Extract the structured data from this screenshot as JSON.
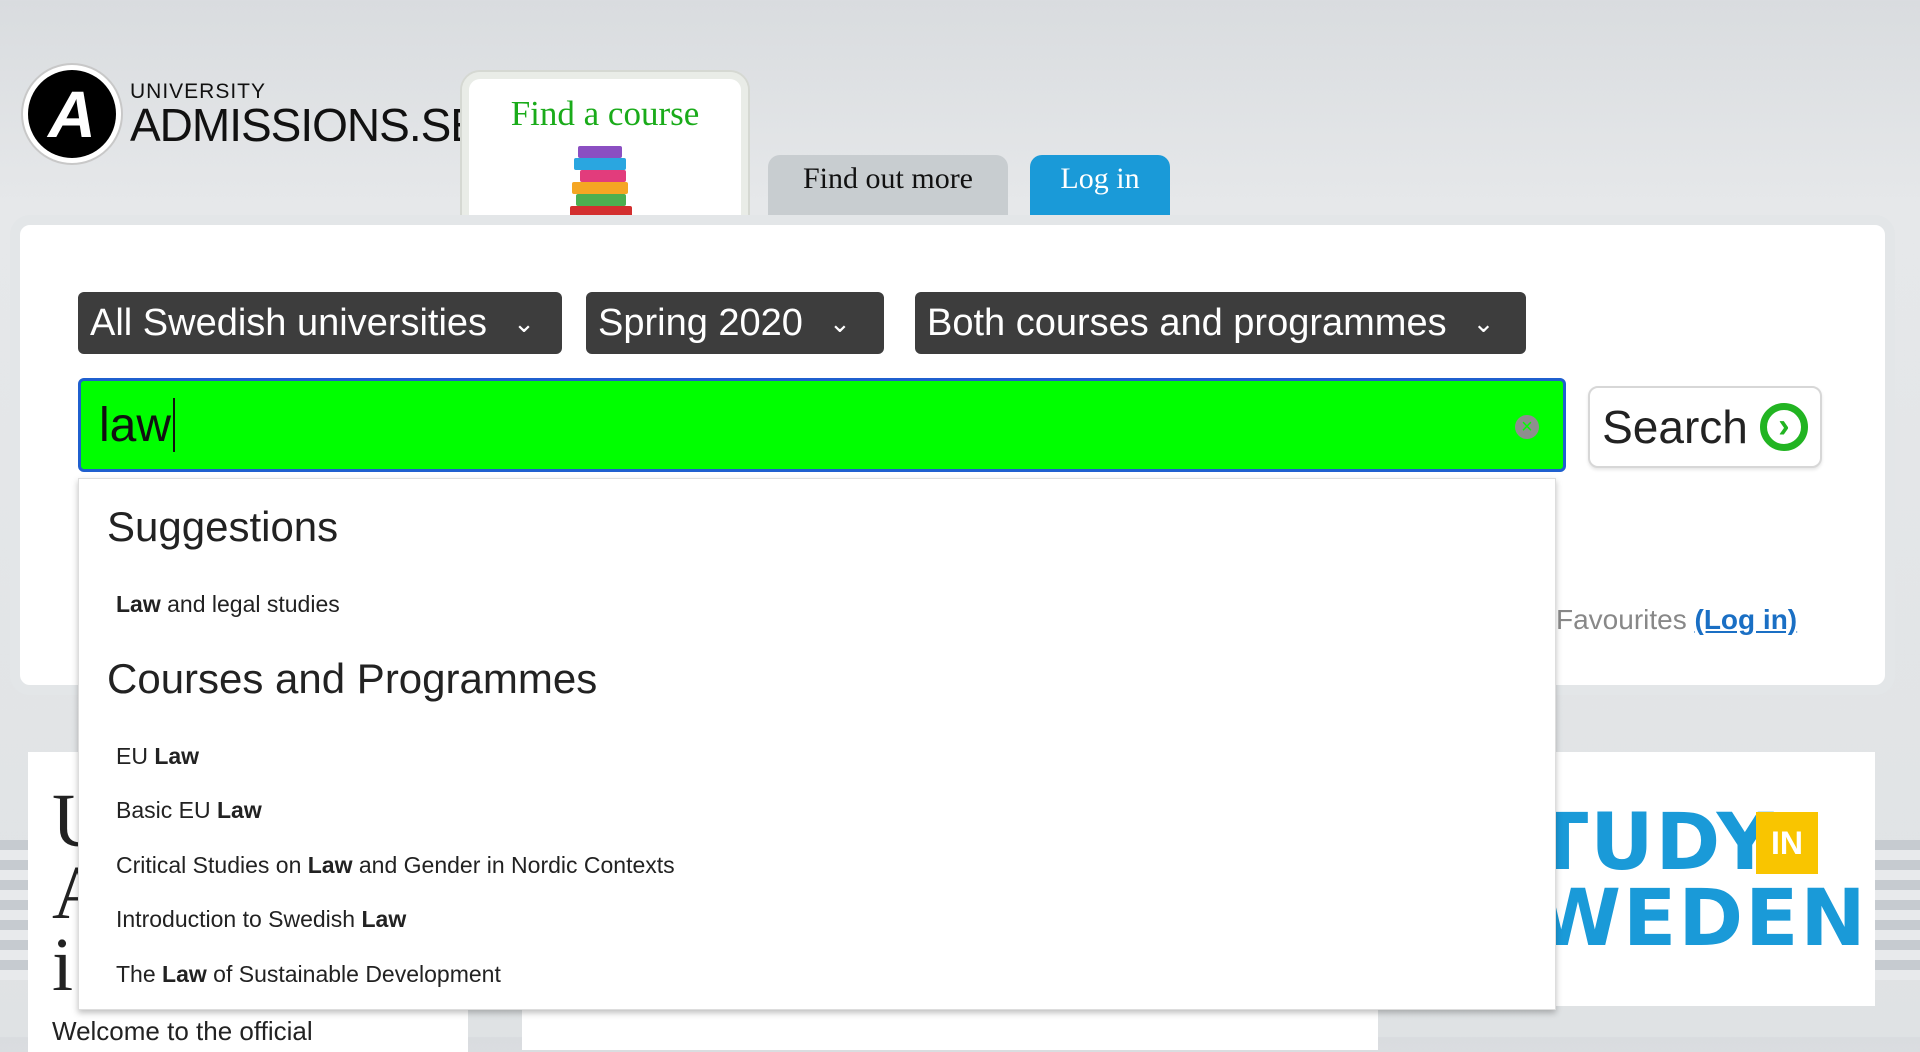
{
  "logo": {
    "small": "UNIVERSITY",
    "big": "ADMISSIONS.SE",
    "mark": "A"
  },
  "tabs": {
    "find": "Find a course",
    "more": "Find out more",
    "login": "Log in"
  },
  "filters": {
    "universities": "All Swedish universities",
    "semester": "Spring 2020",
    "type": "Both courses and programmes",
    "chevron": "⌄"
  },
  "search": {
    "value": "law",
    "button": "Search",
    "clear_icon": "clear-x-icon",
    "go_icon": "arrow-right-circle-icon"
  },
  "favourites": {
    "label": "Favourites",
    "link": "(Log in)"
  },
  "dropdown": {
    "suggestions_heading": "Suggestions",
    "suggestions": [
      {
        "bold": "Law",
        "rest": " and legal studies"
      }
    ],
    "courses_heading": "Courses and Programmes",
    "courses": [
      {
        "pre": "EU ",
        "bold": "Law",
        "post": ""
      },
      {
        "pre": "Basic EU ",
        "bold": "Law",
        "post": ""
      },
      {
        "pre": "Critical Studies on ",
        "bold": "Law",
        "post": " and Gender in Nordic Contexts"
      },
      {
        "pre": "Introduction to Swedish ",
        "bold": "Law",
        "post": ""
      },
      {
        "pre": "The ",
        "bold": "Law",
        "post": " of Sustainable Development"
      }
    ]
  },
  "lower": {
    "card_title_lines": [
      "U",
      "A",
      "i"
    ],
    "welcome": "Welcome to the official",
    "study_in_sweden": {
      "line1": "TUDY",
      "badge": "IN",
      "line2": "WEDEN"
    }
  },
  "colors": {
    "accent_green": "#00ff00",
    "tab_blue": "#1a9ad8",
    "find_green": "#1aab1a"
  }
}
